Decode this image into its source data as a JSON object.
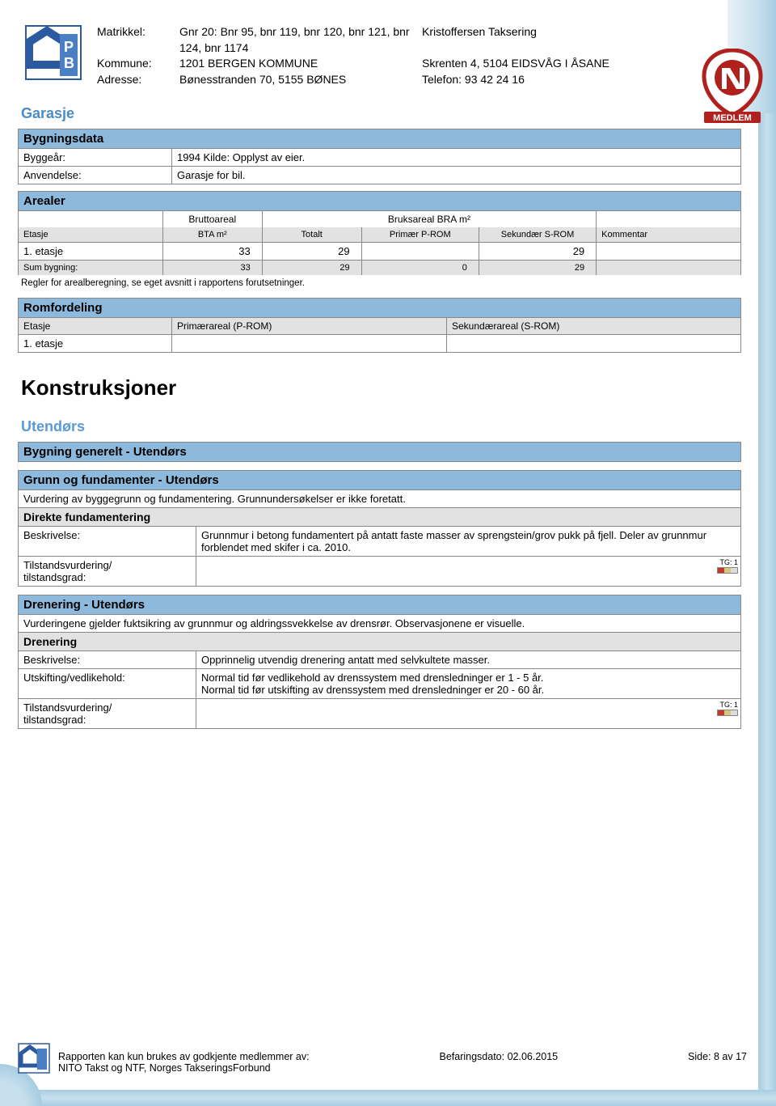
{
  "header": {
    "labels": {
      "matrikkel": "Matrikkel:",
      "kommune": "Kommune:",
      "adresse": "Adresse:"
    },
    "matrikkel": "Gnr 20: Bnr 95, bnr 119, bnr 120, bnr 121, bnr 124, bnr 1174",
    "kommune": "1201 BERGEN KOMMUNE",
    "adresse": "Bønesstranden 70, 5155 BØNES",
    "firm": "Kristoffersen Taksering",
    "firm_addr": "Skrenten 4, 5104 EIDSVÅG I ÅSANE",
    "firm_tel": "Telefon: 93 42 24 16",
    "badge": "MEDLEM"
  },
  "garasje": {
    "title": "Garasje",
    "bygningsdata": {
      "title": "Bygningsdata",
      "rows": [
        {
          "label": "Byggeår:",
          "value": "1994  Kilde: Opplyst av eier."
        },
        {
          "label": "Anvendelse:",
          "value": "Garasje for bil."
        }
      ]
    },
    "arealer": {
      "title": "Arealer",
      "top": {
        "brutto": "Bruttoareal",
        "bruks": "Bruksareal BRA m²"
      },
      "cols": {
        "etasje": "Etasje",
        "bta": "BTA m²",
        "totalt": "Totalt",
        "prom": "Primær P-ROM",
        "srom": "Sekundær S-ROM",
        "kommentar": "Kommentar"
      },
      "rows": [
        {
          "etasje": "1. etasje",
          "bta": "33",
          "totalt": "29",
          "prom": "",
          "srom": "29",
          "kommentar": ""
        }
      ],
      "sum": {
        "label": "Sum bygning:",
        "bta": "33",
        "totalt": "29",
        "prom": "0",
        "srom": "29",
        "kommentar": ""
      },
      "note": "Regler for arealberegning, se eget avsnitt i rapportens forutsetninger."
    },
    "romfordeling": {
      "title": "Romfordeling",
      "cols": {
        "etasje": "Etasje",
        "prom": "Primærareal (P-ROM)",
        "srom": "Sekundærareal (S-ROM)"
      },
      "rows": [
        {
          "etasje": "1. etasje",
          "prom": "",
          "srom": ""
        }
      ]
    }
  },
  "konstruksjoner": {
    "title": "Konstruksjoner",
    "sub": "Utendørs",
    "sections": [
      {
        "title": "Bygning generelt - Utendørs"
      }
    ],
    "grunn": {
      "title": "Grunn og fundamenter - Utendørs",
      "intro": "Vurdering av byggegrunn og fundamentering. Grunnundersøkelser er ikke foretatt.",
      "sub": "Direkte fundamentering",
      "rows": [
        {
          "label": "Beskrivelse:",
          "value": "Grunnmur i betong fundamentert på antatt faste masser av sprengstein/grov pukk på fjell. Deler av grunnmur forblendet med skifer i ca. 2010."
        },
        {
          "label": "Tilstandsvurdering/\ntilstandsgrad:",
          "value": "",
          "tg": "TG: 1"
        }
      ]
    },
    "drenering": {
      "title": "Drenering - Utendørs",
      "intro": "Vurderingene gjelder fuktsikring av grunnmur og aldringssvekkelse av drensrør. Observasjonene er visuelle.",
      "sub": "Drenering",
      "rows": [
        {
          "label": "Beskrivelse:",
          "value": "Opprinnelig utvendig drenering antatt med selvkultete masser."
        },
        {
          "label": "Utskifting/vedlikehold:",
          "value": "Normal tid før vedlikehold av drenssystem med drensledninger er 1 - 5 år.\nNormal tid før utskifting av drenssystem med drensledninger er 20 - 60 år."
        },
        {
          "label": "Tilstandsvurdering/\ntilstandsgrad:",
          "value": "",
          "tg": "TG: 1"
        }
      ]
    }
  },
  "footer": {
    "left": "Rapporten kan kun brukes av godkjente medlemmer av:\nNITO Takst og NTF, Norges TakseringsForbund",
    "mid": "Befaringsdato: 02.06.2015",
    "right": "Side: 8 av 17"
  }
}
